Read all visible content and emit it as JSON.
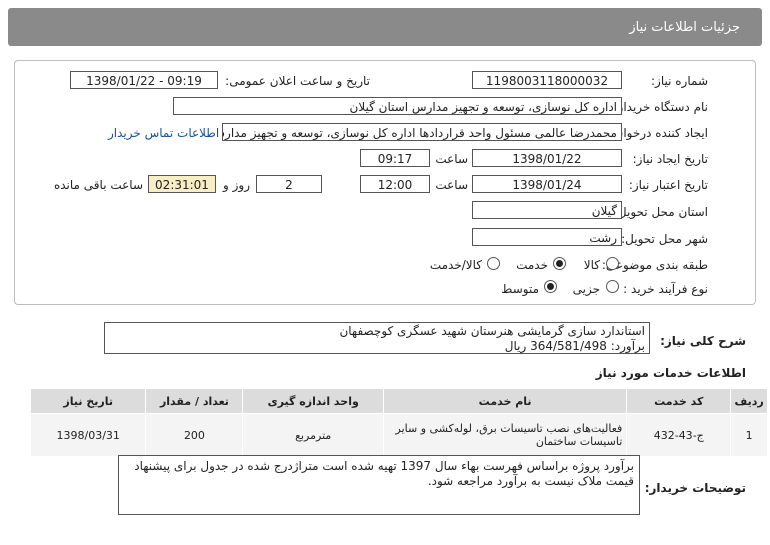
{
  "header": {
    "title": "جزئیات اطلاعات نیاز"
  },
  "form": {
    "need_number_label": "شماره نیاز:",
    "need_number": "1198003118000032",
    "announce_label": "تاریخ و ساعت اعلان عمومی:",
    "announce_value": "1398/01/22 - 09:19",
    "buyer_org_label": "نام دستگاه خریدار:",
    "buyer_org": "اداره کل نوسازی، توسعه و تجهیز مدارس استان گیلان",
    "requester_label": "ایجاد کننده درخواست:",
    "requester": "محمدرضا عالمی مسئول واحد قراردادها اداره کل نوسازی، توسعه و تجهیز مدارس",
    "contact_link": "اطلاعات تماس خریدار",
    "create_date_label": "تاریخ ایجاد نیاز:",
    "create_date": "1398/01/22",
    "time_label": "ساعت",
    "create_time": "09:17",
    "validity_label": "تاریخ اعتبار نیاز:",
    "validity_date": "1398/01/24",
    "validity_time": "12:00",
    "days": "2",
    "days_label": "روز و",
    "remaining": "02:31:01",
    "remaining_label": "ساعت باقی مانده",
    "province_label": "استان محل تحویل:",
    "province": "گیلان",
    "city_label": "شهر محل تحویل:",
    "city": "رشت",
    "category_label": "طبقه بندی موضوعی:",
    "category_options": [
      "کالا",
      "خدمت",
      "کالا/خدمت"
    ],
    "process_label": "نوع فرآیند خرید :",
    "process_options": [
      "جزیی",
      "متوسط"
    ]
  },
  "summary": {
    "label": "شرح کلی نیاز:",
    "line1": "استاندارد سازی گرمایشی هنرستان شهید عسگری کوچصفهان",
    "line2": "برآورد: 364/581/498 ریال"
  },
  "services": {
    "title": "اطلاعات خدمات مورد نیاز",
    "headers": [
      "ردیف",
      "کد خدمت",
      "نام خدمت",
      "واحد اندازه گیری",
      "تعداد / مقدار",
      "تاریخ نیاز"
    ],
    "rows": [
      [
        "1",
        "ج-43-432",
        "فعالیت‌های نصب تاسیسات برق، لوله‌کشی و سایر تاسیسات ساختمان",
        "مترمربع",
        "200",
        "1398/03/31"
      ]
    ]
  },
  "notes": {
    "label": "توضیحات خریدار:",
    "text": "برآورد پروژه براساس فهرست بهاء سال 1397 تهیه شده است متراژدرج شده در جدول برای پیشنهاد قیمت ملاک نیست به برآورد مراجعه شود."
  }
}
